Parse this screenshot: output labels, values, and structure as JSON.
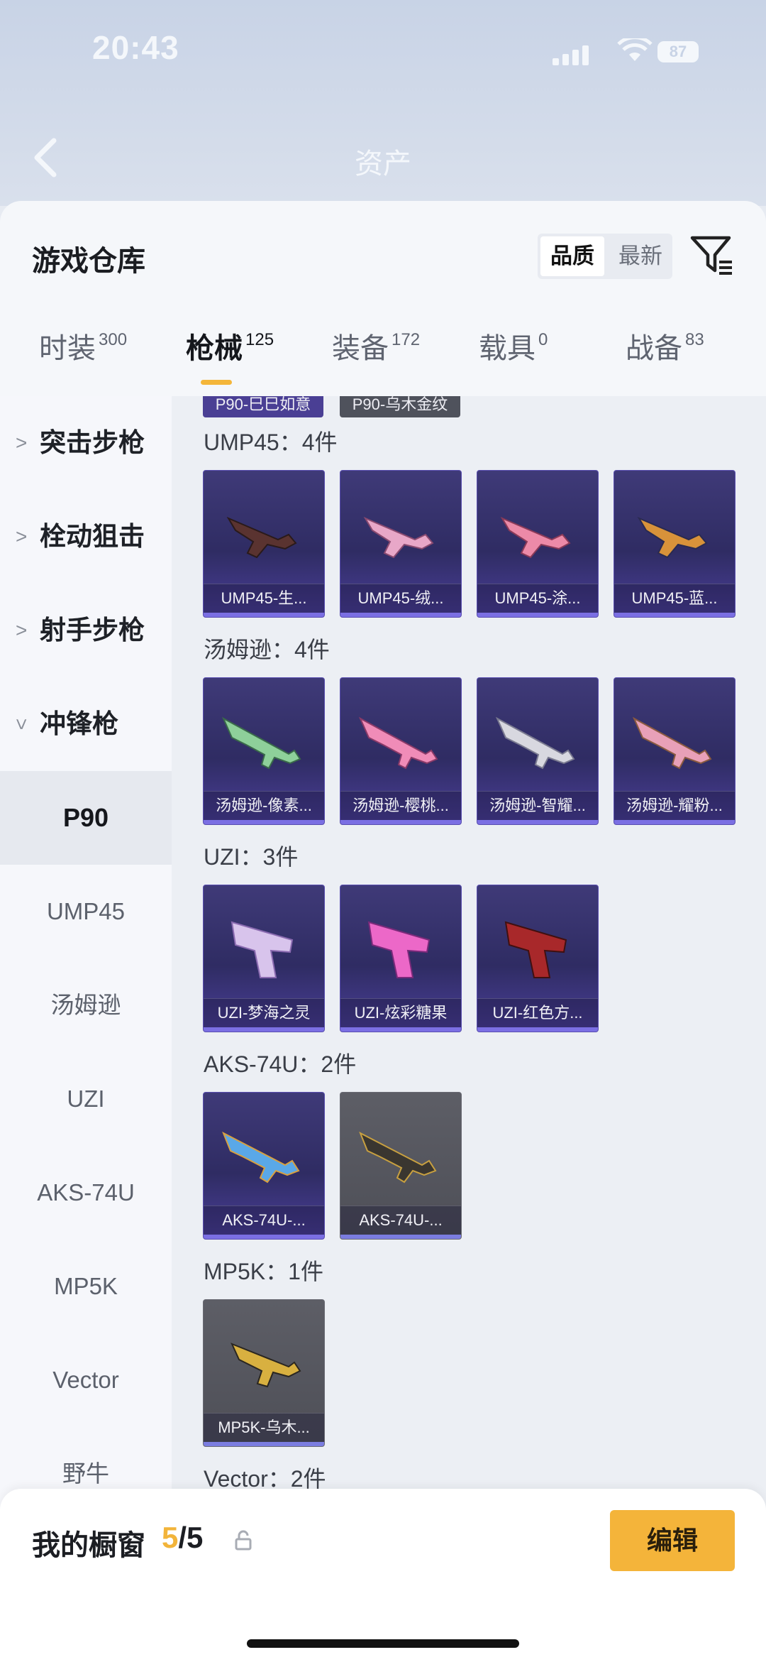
{
  "status": {
    "time": "20:43",
    "battery": "87"
  },
  "nav": {
    "title": "资产"
  },
  "panel": {
    "title": "游戏仓库",
    "sort": {
      "quality": "品质",
      "newest": "最新"
    }
  },
  "tabs": [
    {
      "label": "时装",
      "count": "300"
    },
    {
      "label": "枪械",
      "count": "125"
    },
    {
      "label": "装备",
      "count": "172"
    },
    {
      "label": "载具",
      "count": "0"
    },
    {
      "label": "战备",
      "count": "83"
    }
  ],
  "sidebar": {
    "categories": [
      "突击步枪",
      "栓动狙击",
      "射手步枪",
      "冲锋枪"
    ],
    "subs": [
      "P90",
      "UMP45",
      "汤姆逊",
      "UZI",
      "AKS-74U",
      "MP5K",
      "Vector",
      "野牛"
    ]
  },
  "content": {
    "top_partial": [
      "P90-巳巳如意",
      "P90-乌木金纹"
    ],
    "sections": [
      {
        "title": "UMP45：4件",
        "items": [
          "UMP45-生...",
          "UMP45-绒...",
          "UMP45-涂...",
          "UMP45-蓝..."
        ]
      },
      {
        "title": "汤姆逊：4件",
        "items": [
          "汤姆逊-像素...",
          "汤姆逊-樱桃...",
          "汤姆逊-智耀...",
          "汤姆逊-耀粉..."
        ]
      },
      {
        "title": "UZI：3件",
        "items": [
          "UZI-梦海之灵",
          "UZI-炫彩糖果",
          "UZI-红色方..."
        ]
      },
      {
        "title": "AKS-74U：2件",
        "items": [
          "AKS-74U-...",
          "AKS-74U-..."
        ]
      },
      {
        "title": "MP5K：1件",
        "items": [
          "MP5K-乌木..."
        ]
      },
      {
        "title": "Vector：2件",
        "items": []
      }
    ]
  },
  "bottom": {
    "title": "我的橱窗",
    "count": "5",
    "separator": "/",
    "max": "5",
    "edit": "编辑"
  },
  "colors": {
    "accent": "#f4b43a",
    "card_purple": "#3f3a78",
    "card_grey": "#5d5e66"
  }
}
